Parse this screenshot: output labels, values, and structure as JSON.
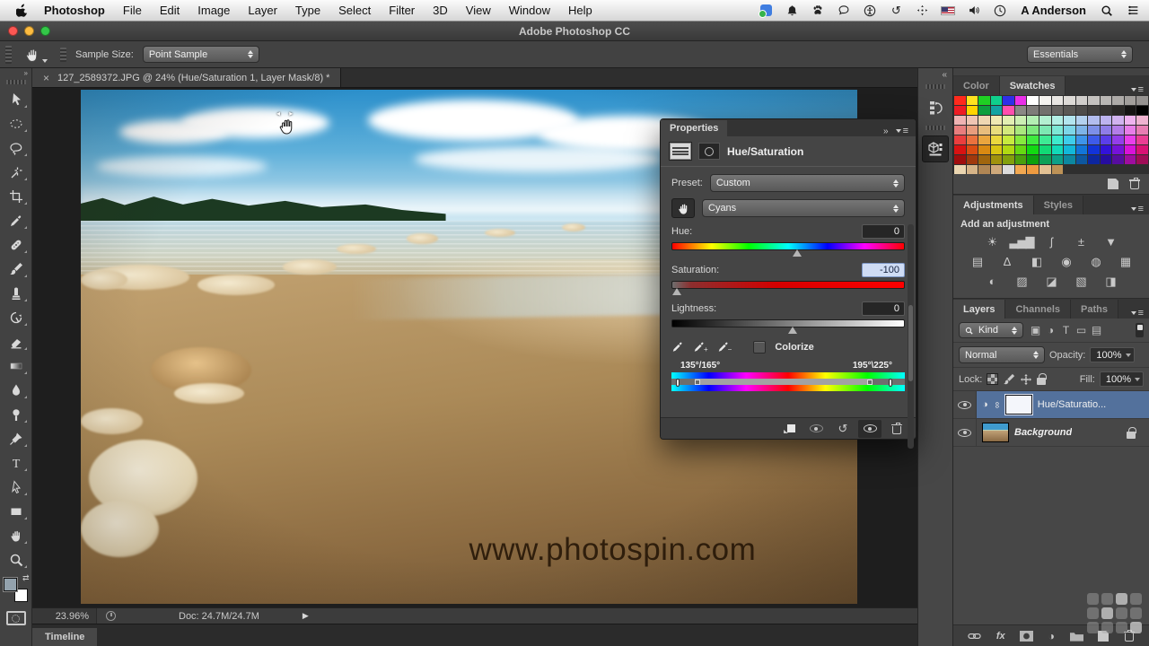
{
  "theme": {
    "selected_layer_color": "#53719c",
    "selected_field_color": "#cfdcf4",
    "panel_bg": "#474747",
    "canvas_bg": "#1e1e1e"
  },
  "menu_bar": {
    "items": [
      "Photoshop",
      "File",
      "Edit",
      "Image",
      "Layer",
      "Type",
      "Select",
      "Filter",
      "3D",
      "View",
      "Window",
      "Help"
    ],
    "username": "A Anderson",
    "status_icons": [
      "dropbox-icon",
      "notifications-bell-icon",
      "paw-icon",
      "messages-bubble-icon",
      "accessibility-icon",
      "time-machine-icon",
      "keyboard-nav-icon",
      "input-language-flag-icon",
      "volume-icon",
      "clock-icon",
      "spotlight-search-icon",
      "notification-center-icon"
    ]
  },
  "title_bar": {
    "title": "Adobe Photoshop CC"
  },
  "options_bar": {
    "sample_size_label": "Sample Size:",
    "sample_size_value": "Point Sample",
    "workspace_value": "Essentials"
  },
  "document": {
    "close_glyph": "×",
    "tab_title": "127_2589372.JPG @ 24% (Hue/Saturation 1, Layer Mask/8) *",
    "watermark": "www.photospin.com"
  },
  "toolbar": {
    "tools": [
      "move",
      "marquee",
      "lasso",
      "magic-wand",
      "crop",
      "eyedropper",
      "healing-brush",
      "brush",
      "clone-stamp",
      "history-brush",
      "eraser",
      "gradient",
      "blur",
      "dodge",
      "pen",
      "type",
      "path-selection",
      "shape",
      "hand",
      "zoom"
    ]
  },
  "properties_panel": {
    "tab": "Properties",
    "title": "Hue/Saturation",
    "preset_label": "Preset:",
    "preset_value": "Custom",
    "channel_value": "Cyans",
    "hue_label": "Hue:",
    "hue_value": "0",
    "saturation_label": "Saturation:",
    "saturation_value": "-100",
    "lightness_label": "Lightness:",
    "lightness_value": "0",
    "colorize_label": "Colorize",
    "range_left_label": "135°/165°",
    "range_right_label": "195°\\225°"
  },
  "swatches_panel": {
    "tabs": [
      "Color",
      "Swatches"
    ],
    "colors": [
      "#ff2a1c",
      "#ffe21f",
      "#1fd023",
      "#0fd08c",
      "#2f2fe8",
      "#e82fe8",
      "#ffffff",
      "#f4f2ee",
      "#e9e6e2",
      "#dddad6",
      "#d1cecb",
      "#c5c2bf",
      "#b9b6b3",
      "#adaaa7",
      "#a19e9b",
      "#959290",
      "#ed1c24",
      "#ffd400",
      "#0e9e3e",
      "#12a3a3",
      "#ff4fae",
      "#8a8885",
      "#7e7c79",
      "#72706d",
      "#666461",
      "#5a5855",
      "#4e4c4a",
      "#42403e",
      "#363432",
      "#2a2826",
      "#151413",
      "#000000",
      "hsl(0,65%,82%)",
      "hsl(18,65%,82%)",
      "hsl(36,65%,82%)",
      "hsl(54,65%,82%)",
      "hsl(72,65%,82%)",
      "hsl(95,65%,82%)",
      "hsl(120,65%,82%)",
      "hsl(150,65%,82%)",
      "hsl(170,65%,82%)",
      "hsl(190,65%,82%)",
      "hsl(210,65%,82%)",
      "hsl(230,65%,82%)",
      "hsl(250,65%,82%)",
      "hsl(270,65%,82%)",
      "hsl(300,65%,82%)",
      "hsl(330,65%,82%)",
      "hsl(0,70%,70%)",
      "hsl(18,70%,70%)",
      "hsl(36,70%,70%)",
      "hsl(54,70%,70%)",
      "hsl(72,70%,70%)",
      "hsl(95,70%,70%)",
      "hsl(120,70%,70%)",
      "hsl(150,70%,70%)",
      "hsl(170,70%,70%)",
      "hsl(190,70%,70%)",
      "hsl(210,70%,70%)",
      "hsl(230,70%,70%)",
      "hsl(250,70%,70%)",
      "hsl(270,70%,70%)",
      "hsl(300,70%,70%)",
      "hsl(330,70%,70%)",
      "hsl(0,80%,58%)",
      "hsl(18,80%,58%)",
      "hsl(36,80%,58%)",
      "hsl(54,80%,58%)",
      "hsl(72,80%,58%)",
      "hsl(95,80%,58%)",
      "hsl(120,80%,58%)",
      "hsl(150,80%,58%)",
      "hsl(170,80%,58%)",
      "hsl(190,80%,58%)",
      "hsl(210,80%,58%)",
      "hsl(230,80%,58%)",
      "hsl(250,80%,58%)",
      "hsl(270,80%,58%)",
      "hsl(300,80%,58%)",
      "hsl(330,80%,58%)",
      "hsl(0,85%,46%)",
      "hsl(18,85%,46%)",
      "hsl(36,85%,46%)",
      "hsl(54,85%,46%)",
      "hsl(72,85%,46%)",
      "hsl(95,85%,46%)",
      "hsl(120,85%,46%)",
      "hsl(150,85%,46%)",
      "hsl(170,85%,46%)",
      "hsl(190,85%,46%)",
      "hsl(210,85%,46%)",
      "hsl(230,85%,46%)",
      "hsl(250,85%,46%)",
      "hsl(270,85%,46%)",
      "hsl(300,85%,46%)",
      "hsl(330,85%,46%)",
      "hsl(0,85%,34%)",
      "hsl(18,85%,34%)",
      "hsl(36,85%,34%)",
      "hsl(54,85%,34%)",
      "hsl(72,85%,34%)",
      "hsl(95,85%,34%)",
      "hsl(120,85%,34%)",
      "hsl(150,85%,34%)",
      "hsl(170,85%,34%)",
      "hsl(190,85%,34%)",
      "hsl(210,85%,34%)",
      "hsl(230,85%,34%)",
      "hsl(250,85%,34%)",
      "hsl(270,85%,34%)",
      "hsl(300,85%,34%)",
      "hsl(330,85%,34%)",
      "#ead5b0",
      "#d6b488",
      "#b08654",
      "#cfa97b",
      "#dcdcdc",
      "#f2a851",
      "#ee9a40",
      "#e2c093",
      "#bd9257"
    ]
  },
  "adjustments_panel": {
    "tabs": [
      "Adjustments",
      "Styles"
    ],
    "prompt": "Add an adjustment",
    "row1": [
      {
        "name": "brightness-contrast",
        "glyph": "☀"
      },
      {
        "name": "levels",
        "glyph": "▃▅▇"
      },
      {
        "name": "curves",
        "glyph": "ʃ"
      },
      {
        "name": "exposure",
        "glyph": "±"
      },
      {
        "name": "vibrance",
        "glyph": "▼"
      }
    ],
    "row2": [
      {
        "name": "hue-saturation",
        "glyph": "▤"
      },
      {
        "name": "color-balance",
        "glyph": "∆"
      },
      {
        "name": "black-white",
        "glyph": "◧"
      },
      {
        "name": "photo-filter",
        "glyph": "◉"
      },
      {
        "name": "channel-mixer",
        "glyph": "◍"
      },
      {
        "name": "color-lookup",
        "glyph": "▦"
      }
    ],
    "row3": [
      {
        "name": "invert",
        "glyph": "◐"
      },
      {
        "name": "posterize",
        "glyph": "▨"
      },
      {
        "name": "threshold",
        "glyph": "◪"
      },
      {
        "name": "gradient-map",
        "glyph": "▧"
      },
      {
        "name": "selective-color",
        "glyph": "◨"
      }
    ]
  },
  "layers_panel": {
    "tabs": [
      "Layers",
      "Channels",
      "Paths"
    ],
    "filter_label": "Kind",
    "filter_icons": [
      {
        "name": "filter-pixel-layers",
        "glyph": "▣"
      },
      {
        "name": "filter-adjustment-layers",
        "glyph": "◑"
      },
      {
        "name": "filter-type-layers",
        "glyph": "T"
      },
      {
        "name": "filter-shape-layers",
        "glyph": "▭"
      },
      {
        "name": "filter-smart-objects",
        "glyph": "▤"
      }
    ],
    "blend_mode": "Normal",
    "opacity_label": "Opacity:",
    "opacity_value": "100%",
    "lock_label": "Lock:",
    "fill_label": "Fill:",
    "fill_value": "100%",
    "layers": [
      {
        "name": "Hue/Saturatio...",
        "selected": true
      },
      {
        "name": "Background",
        "selected": false
      }
    ]
  },
  "status_bar": {
    "zoom_value": "23.96%",
    "doc_info": "Doc: 24.7M/24.7M"
  },
  "timeline_panel": {
    "tab": "Timeline"
  },
  "glyphs": {
    "double_chevron_right": "»",
    "double_chevron_left": "«",
    "panel_menu": "≡",
    "reset": "↺",
    "play": "▶",
    "half_circle": "◑",
    "infinity": "∞",
    "fx": "fx",
    "swap_arrows": "⇄",
    "cursor_arrows": "◂ ▸"
  }
}
